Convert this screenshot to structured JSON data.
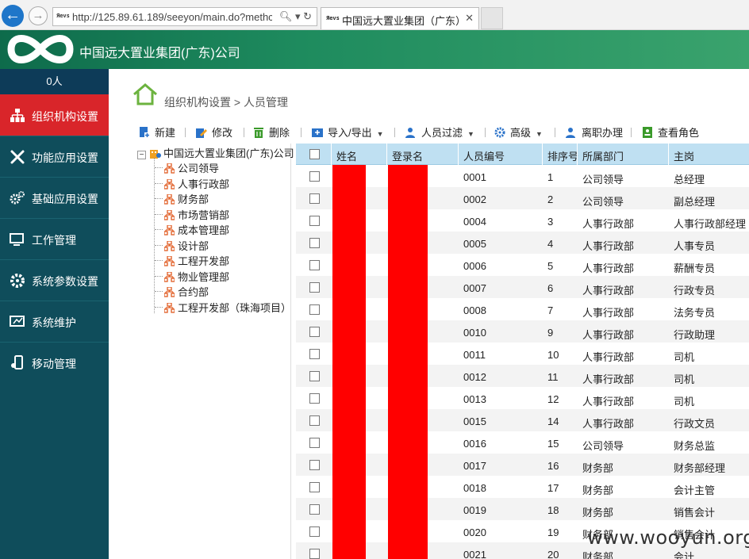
{
  "browser": {
    "url": "http://125.89.61.189/seeyon/main.do?methc",
    "favicon_text": "Яеvs",
    "tab_title": "中国远大置业集团（广东）..."
  },
  "app": {
    "company_name": "中国远大置业集团(广东)公司",
    "brand_color": "#1e8b5e"
  },
  "sidebar": {
    "user_count": "0人",
    "items": [
      {
        "label": "组织机构设置",
        "icon": "org-chart-icon",
        "active": true
      },
      {
        "label": "功能应用设置",
        "icon": "tools-icon",
        "active": false
      },
      {
        "label": "基础应用设置",
        "icon": "gears-icon",
        "active": false
      },
      {
        "label": "工作管理",
        "icon": "monitor-user-icon",
        "active": false
      },
      {
        "label": "系统参数设置",
        "icon": "gear-icon",
        "active": false
      },
      {
        "label": "系统维护",
        "icon": "maintenance-icon",
        "active": false
      },
      {
        "label": "移动管理",
        "icon": "mobile-user-icon",
        "active": false
      }
    ]
  },
  "breadcrumb": {
    "text": "组织机构设置 > 人员管理"
  },
  "toolbar": {
    "new": "新建",
    "edit": "修改",
    "delete": "删除",
    "import_export": "导入/导出",
    "filter": "人员过滤",
    "advanced": "高级",
    "resign": "离职办理",
    "view_roles": "查看角色"
  },
  "tree": {
    "root": "中国远大置业集团(广东)公司",
    "nodes": [
      "公司领导",
      "人事行政部",
      "财务部",
      "市场营销部",
      "成本管理部",
      "设计部",
      "工程开发部",
      "物业管理部",
      "合约部",
      "工程开发部（珠海项目）"
    ]
  },
  "grid": {
    "columns": {
      "name": "姓名",
      "login": "登录名",
      "code": "人员编号",
      "order": "排序号",
      "dept": "所属部门",
      "post": "主岗"
    },
    "rows": [
      {
        "code": "0001",
        "order": "1",
        "dept": "公司领导",
        "post": "总经理"
      },
      {
        "code": "0002",
        "order": "2",
        "dept": "公司领导",
        "post": "副总经理"
      },
      {
        "code": "0004",
        "order": "3",
        "dept": "人事行政部",
        "post": "人事行政部经理"
      },
      {
        "code": "0005",
        "order": "4",
        "dept": "人事行政部",
        "post": "人事专员"
      },
      {
        "code": "0006",
        "order": "5",
        "dept": "人事行政部",
        "post": "薪酬专员"
      },
      {
        "code": "0007",
        "order": "6",
        "dept": "人事行政部",
        "post": "行政专员"
      },
      {
        "code": "0008",
        "order": "7",
        "dept": "人事行政部",
        "post": "法务专员"
      },
      {
        "code": "0010",
        "order": "9",
        "dept": "人事行政部",
        "post": "行政助理"
      },
      {
        "code": "0011",
        "order": "10",
        "dept": "人事行政部",
        "post": "司机"
      },
      {
        "code": "0012",
        "order": "11",
        "dept": "人事行政部",
        "post": "司机"
      },
      {
        "code": "0013",
        "order": "12",
        "dept": "人事行政部",
        "post": "司机"
      },
      {
        "code": "0015",
        "order": "14",
        "dept": "人事行政部",
        "post": "行政文员"
      },
      {
        "code": "0016",
        "order": "15",
        "dept": "公司领导",
        "post": "财务总监"
      },
      {
        "code": "0017",
        "order": "16",
        "dept": "财务部",
        "post": "财务部经理"
      },
      {
        "code": "0018",
        "order": "17",
        "dept": "财务部",
        "post": "会计主管"
      },
      {
        "code": "0019",
        "order": "18",
        "dept": "财务部",
        "post": "销售会计"
      },
      {
        "code": "0020",
        "order": "19",
        "dept": "财务部",
        "post": "销售会计"
      },
      {
        "code": "0021",
        "order": "20",
        "dept": "财务部",
        "post": "会计"
      }
    ]
  },
  "watermark": "www.wooyun.org"
}
